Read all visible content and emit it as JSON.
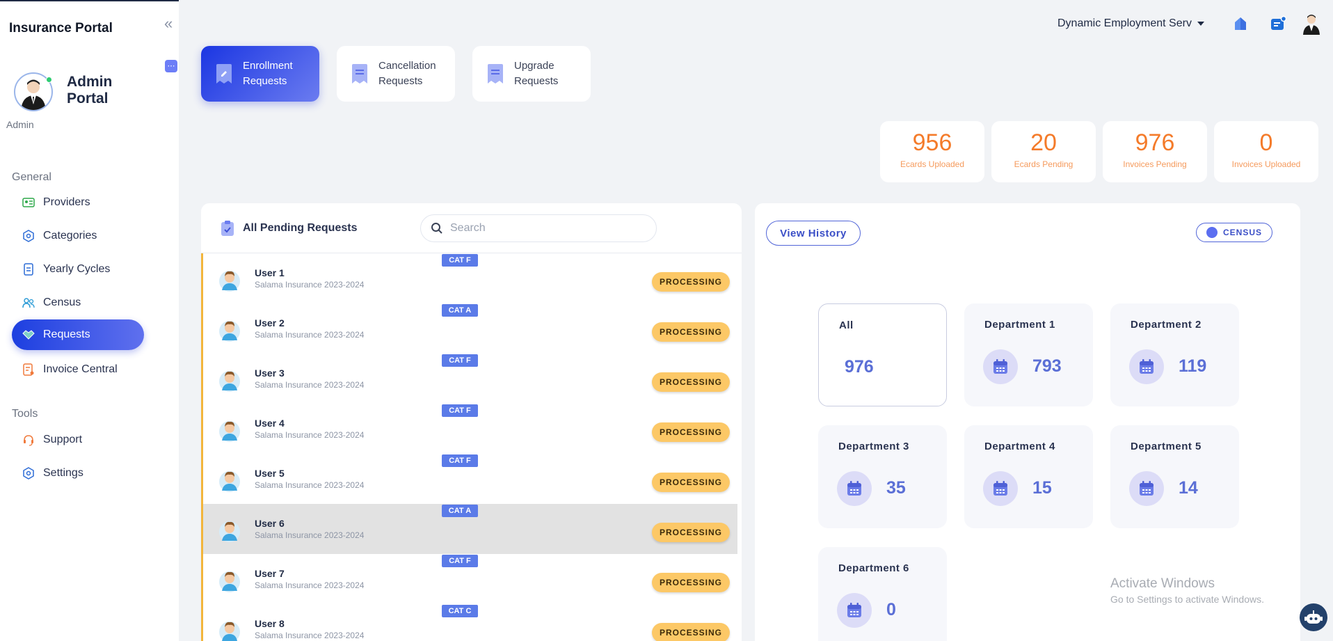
{
  "sidebar": {
    "brand": "Insurance Portal",
    "profile_title": "Admin Portal",
    "role": "Admin",
    "section_general": "General",
    "section_tools": "Tools",
    "items": [
      {
        "label": "Providers",
        "icon": "id-card-icon"
      },
      {
        "label": "Categories",
        "icon": "hexagon-icon"
      },
      {
        "label": "Yearly Cycles",
        "icon": "document-icon"
      },
      {
        "label": "Census",
        "icon": "users-icon"
      },
      {
        "label": "Requests",
        "icon": "handshake-icon",
        "active": true
      },
      {
        "label": "Invoice Central",
        "icon": "invoice-icon"
      }
    ],
    "tools": [
      {
        "label": "Support",
        "icon": "headset-icon"
      },
      {
        "label": "Settings",
        "icon": "gear-icon"
      }
    ]
  },
  "header": {
    "company": "Dynamic Employment Serv"
  },
  "tabs": [
    {
      "label": "Enrollment Requests",
      "active": true
    },
    {
      "label": "Cancellation Requests",
      "active": false
    },
    {
      "label": "Upgrade Requests",
      "active": false
    }
  ],
  "stats": [
    {
      "value": "956",
      "label": "Ecards Uploaded"
    },
    {
      "value": "20",
      "label": "Ecards Pending"
    },
    {
      "value": "976",
      "label": "Invoices Pending"
    },
    {
      "value": "0",
      "label": "Invoices Uploaded"
    }
  ],
  "requests": {
    "title": "All Pending Requests",
    "search_placeholder": "Search",
    "rows": [
      {
        "name": "User 1",
        "subtitle": "Salama Insurance 2023-2024",
        "category": "CAT F",
        "status": "PROCESSING"
      },
      {
        "name": "User 2",
        "subtitle": "Salama Insurance 2023-2024",
        "category": "CAT A",
        "status": "PROCESSING"
      },
      {
        "name": "User 3",
        "subtitle": "Salama Insurance 2023-2024",
        "category": "CAT F",
        "status": "PROCESSING"
      },
      {
        "name": "User 4",
        "subtitle": "Salama Insurance 2023-2024",
        "category": "CAT F",
        "status": "PROCESSING"
      },
      {
        "name": "User 5",
        "subtitle": "Salama Insurance 2023-2024",
        "category": "CAT F",
        "status": "PROCESSING"
      },
      {
        "name": "User 6",
        "subtitle": "Salama Insurance 2023-2024",
        "category": "CAT A",
        "status": "PROCESSING",
        "selected": true
      },
      {
        "name": "User 7",
        "subtitle": "Salama Insurance 2023-2024",
        "category": "CAT F",
        "status": "PROCESSING"
      },
      {
        "name": "User 8",
        "subtitle": "Salama Insurance 2023-2024",
        "category": "CAT C",
        "status": "PROCESSING"
      }
    ]
  },
  "right": {
    "history_label": "View History",
    "census_label": "CENSUS",
    "departments": [
      {
        "name": "All",
        "value": "976"
      },
      {
        "name": "Department 1",
        "value": "793"
      },
      {
        "name": "Department 2",
        "value": "119"
      },
      {
        "name": "Department 3",
        "value": "35"
      },
      {
        "name": "Department 4",
        "value": "15"
      },
      {
        "name": "Department 5",
        "value": "14"
      },
      {
        "name": "Department 6",
        "value": "0"
      }
    ]
  },
  "watermark": {
    "line1": "Activate Windows",
    "line2": "Go to Settings to activate Windows."
  },
  "colors": {
    "accent": "#1d3fe0",
    "stat_orange": "#f47b2a",
    "status_badge": "#fcc866",
    "category_badge": "#5b7be8"
  }
}
